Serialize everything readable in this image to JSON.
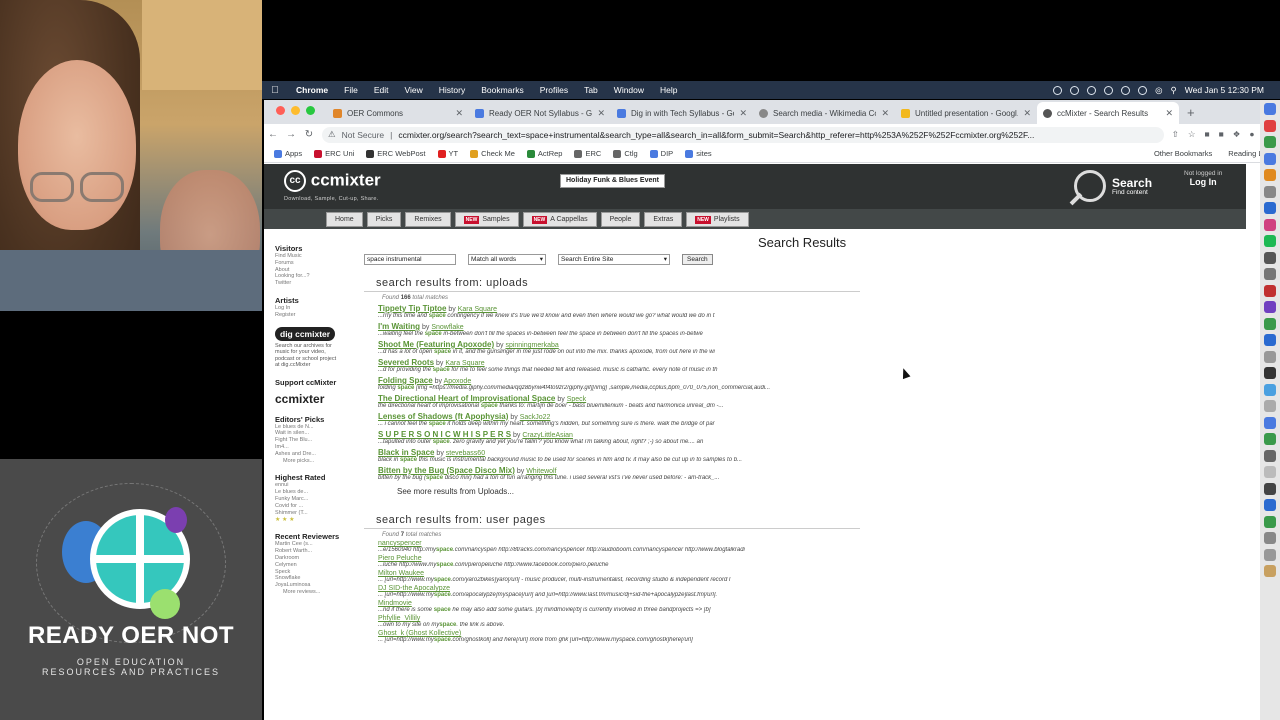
{
  "overlay": {
    "title": "READY OER NOT",
    "subtitle_line1": "OPEN EDUCATION",
    "subtitle_line2": "RESOURCES AND PRACTICES"
  },
  "menubar": {
    "app": "Chrome",
    "items": [
      "File",
      "Edit",
      "View",
      "History",
      "Bookmarks",
      "Profiles",
      "Tab",
      "Window",
      "Help"
    ],
    "datetime": "Wed Jan 5  12:30 PM"
  },
  "tabs": [
    {
      "label": "OER Commons",
      "color": "#e0862a"
    },
    {
      "label": "Ready OER Not Syllabus - Go...",
      "color": "#4a7ae0"
    },
    {
      "label": "Dig in with Tech Syllabus - Go...",
      "color": "#4a7ae0"
    },
    {
      "label": "Search media - Wikimedia Co...",
      "color": "#888888"
    },
    {
      "label": "Untitled presentation - Googl...",
      "color": "#f2b81d"
    },
    {
      "label": "ccMixter - Search Results",
      "color": "#555555"
    }
  ],
  "toolbar": {
    "not_secure": "Not Secure",
    "url": "ccmixter.org/search?search_text=space+instrumental&search_type=all&search_in=all&form_submit=Search&http_referer=http%253A%252F%252Fccmixter.org%252F..."
  },
  "bookmarks": [
    {
      "label": "Apps",
      "color": "#4a7ae0"
    },
    {
      "label": "ERC Uni",
      "color": "#c8102e"
    },
    {
      "label": "ERC WebPost",
      "color": "#333333"
    },
    {
      "label": "YT",
      "color": "#e02020"
    },
    {
      "label": "Check Me",
      "color": "#e0a020"
    },
    {
      "label": "ActRep",
      "color": "#2a8a3a"
    },
    {
      "label": "ERC",
      "color": "#666666"
    },
    {
      "label": "Ctlg",
      "color": "#666666"
    },
    {
      "label": "DIP",
      "color": "#4a7ae0"
    },
    {
      "label": "sites",
      "color": "#4a7ae0"
    }
  ],
  "bookmarks_right": {
    "other": "Other Bookmarks",
    "reading": "Reading List"
  },
  "site": {
    "logo": "ccmixter",
    "logo_cc": "cc",
    "tagline": "Download, Sample, Cut-up, Share.",
    "event": "Holiday Funk & Blues Event",
    "search_title": "Search",
    "search_sub": "Find content",
    "not_logged": "Not logged in",
    "login": "Log In"
  },
  "nav": [
    {
      "label": "Home",
      "new": false
    },
    {
      "label": "Picks",
      "new": false
    },
    {
      "label": "Remixes",
      "new": false
    },
    {
      "label": "Samples",
      "new": true
    },
    {
      "label": "A Cappellas",
      "new": true
    },
    {
      "label": "People",
      "new": false
    },
    {
      "label": "Extras",
      "new": false
    },
    {
      "label": "Playlists",
      "new": true
    }
  ],
  "nav_new_badge": "NEW",
  "sidebar": {
    "visitors_h": "Visitors",
    "visitors": [
      "Find Music",
      "Forums",
      "About",
      "Looking for...?",
      "Twitter"
    ],
    "artists_h": "Artists",
    "artists": [
      "Log In",
      "Register"
    ],
    "dig_logo": "dig ccmixter",
    "dig_text": [
      "Search our archives for",
      "music for your video,",
      "podcast or school project",
      "at dig.ccMixter"
    ],
    "support_h": "Support ccMixter",
    "support_logo": "ccmixter",
    "editors_h": "Editors' Picks",
    "editors": [
      "Le blues de N...",
      "Wait in silen...",
      "Fight The Blu...",
      "Im4...",
      "Ashes and Dre..."
    ],
    "editors_more": "More picks...",
    "highest_h": "Highest Rated",
    "highest": [
      "ennui",
      "Le blues de...",
      "Funky Marc...",
      "Covid for ...",
      "Shimmer (T..."
    ],
    "highest_stars": "★ ★ ★",
    "reviewers_h": "Recent Reviewers",
    "reviewers": [
      "Martin Cee (s...",
      "Robert Warth...",
      "Darkroom",
      "Celymen",
      "Speck",
      "Snowflake",
      "JoyaLuminosa"
    ],
    "reviewers_more": "More reviews..."
  },
  "results": {
    "title": "Search Results",
    "query": "space instrumental",
    "match": "Match all words",
    "scope": "Search Entire Site",
    "button": "Search",
    "uploads_h": "search results from: uploads",
    "uploads_found_pre": "Found",
    "uploads_found_num": "166",
    "uploads_found_post": "total matches",
    "uploads": [
      {
        "title": "Tippety Tip Tiptoe",
        "artist": "Kara Square",
        "pre": "...rrly this time and ",
        "kw": "space",
        "post": " contingency if we knew it's true we'd know and even then where would we go? what would we do in t"
      },
      {
        "title": "I'm Waiting",
        "artist": "Snowflake",
        "pre": "...waiting feel the ",
        "kw": "space",
        "post": " in-between don't fill the spaces in-between feel the space in between don't fill the spaces in-betwe"
      },
      {
        "title": "Shoot Me (Featuring Apoxode)",
        "artist": "spinningmerkaba",
        "pre": "...d has a lot of open ",
        "kw": "space",
        "post": " in it, and the gunslinger in me just rode on out into the mix. thanks apoxode, from out here in the wi"
      },
      {
        "title": "Severed Roots",
        "artist": "Kara Square",
        "pre": "...d for providing the ",
        "kw": "space",
        "post": " for me to feel some things that needed felt and released. music is cathartic. every note of music in th"
      },
      {
        "title": "Folding Space",
        "artist": "Apoxode",
        "pre": "folding ",
        "kw": "space",
        "post": " [img =https://media.giphy.com/media/qqz8bynw4f4to9zr2/giphy.gif][/img] ,sample,media,ccplus,bpm_070_075,non_commercial,audi..."
      },
      {
        "title": "The Directional Heart of Improvisational Space",
        "artist": "Speck",
        "pre": "the directional heart of improvisational ",
        "kw": "space",
        "post": " thanks to: martijn de boer - bass bluemillenium - beats and harmonica unreal_dm -..."
      },
      {
        "title": "Lenses of Shadows (ft Apophysia)",
        "artist": "SackJo22",
        "pre": "... i cannot feel the ",
        "kw": "space",
        "post": " it holds deep within my heart. something's hidden, but something sure is there. walk the bridge of par"
      },
      {
        "title": "S U P E R S O N I C W H I S P E R S",
        "artist": "CrazyLittleAsian",
        "pre": "...tapulted into outer ",
        "kw": "space",
        "post": ". zero gravity and yet you're fallin'? you know what i'm talking about, right? ;-) so about me.... an"
      },
      {
        "title": "Black in Space",
        "artist": "stevebass60",
        "pre": "black in ",
        "kw": "space",
        "post": " this music is instrumental background music to be used for scenes in film and tv. it may also be cut up in to samples to b..."
      },
      {
        "title": "Bitten by the Bug (Space Disco Mix)",
        "artist": "Whitewolf",
        "pre": "bitten by the bug (",
        "kw": "space",
        "post": " disco mix) had a ton of fun arranging this tune. i used several vst's i've never used before: - am-track_..."
      }
    ],
    "uploads_more": "See more results from Uploads...",
    "users_h": "search results from: user pages",
    "users_found_pre": "Found",
    "users_found_num": "7",
    "users_found_post": "total matches",
    "users": [
      {
        "name": "nancyspencer",
        "pre": "...e/1560940 http://my",
        "kw": "space",
        "post": ".com/nancyspen http://8tracks.com/nancyspencer http://audioboom.com/nancyspencer http://www.blogtalkradi"
      },
      {
        "name": "Piero Peluche",
        "pre": "...luche http://www.my",
        "kw": "space",
        "post": ".com/pieropeluche http://www.facebook.com/piero.peluche"
      },
      {
        "name": "Milton Waukee",
        "pre": "... [url=http://www.my",
        "kw": "space",
        "post": ".com/yaro2bikes]yaro[/url] - music producer, multi-instrumentalist, recording studio & independent record l"
      },
      {
        "name": "DJ SID-the Apocalypze",
        "pre": "... [url=http://www.my",
        "kw": "space",
        "post": ".com/apocalypze]myspace[/url] and [url=http://www.last.fm/music/dj+sid-the+apocalypze]last.fm[/url]."
      },
      {
        "name": "Mindmovie",
        "pre": "...nd if there is some ",
        "kw": "space",
        "post": " he may also add some guitars. [b] mindmovie[/b] is currently involved in three bandprojects => [b]"
      },
      {
        "name": "Phfyllie_Villily",
        "pre": "...own to my site on my",
        "kw": "space",
        "post": ". the link is above."
      },
      {
        "name": "Ghost_k (Ghost Kollective)",
        "pre": "... [url=http://www.my",
        "kw": "space",
        "post": ".com/ghostkoll] and here[/url] more from ghk [url=http://www.myspace.com/ghostk]here[/url]"
      }
    ]
  },
  "colors": {
    "accent_green": "#5a9436",
    "header_dark": "#2f3232",
    "menubar": "#263449"
  }
}
